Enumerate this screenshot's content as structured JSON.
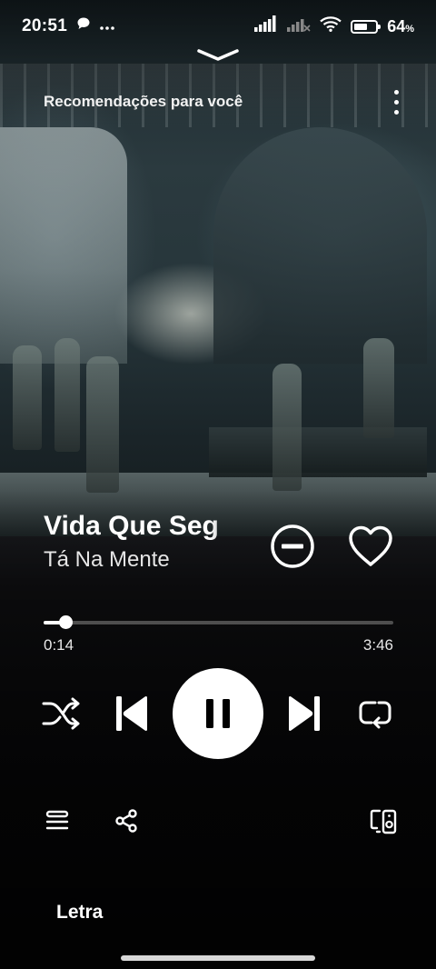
{
  "status_bar": {
    "time": "20:51",
    "battery_text": "64",
    "battery_level_percent": 64,
    "icons": [
      "chat-bubble-icon",
      "more-dots-icon",
      "signal-icon",
      "signal-no-service-icon",
      "wifi-icon",
      "battery-icon"
    ]
  },
  "header": {
    "title": "Recomendações para você"
  },
  "track": {
    "title": "Vida Que Seg",
    "artist": "Tá Na Mente"
  },
  "progress": {
    "elapsed": "0:14",
    "total": "3:46",
    "fraction": 0.062
  },
  "player": {
    "state": "playing",
    "icons": [
      "shuffle-icon",
      "previous-icon",
      "pause-icon",
      "next-icon",
      "repeat-icon"
    ]
  },
  "bottom_actions": {
    "icons": [
      "queue-icon",
      "share-icon",
      "connect-devices-icon"
    ]
  },
  "lyrics": {
    "label": "Letra"
  }
}
